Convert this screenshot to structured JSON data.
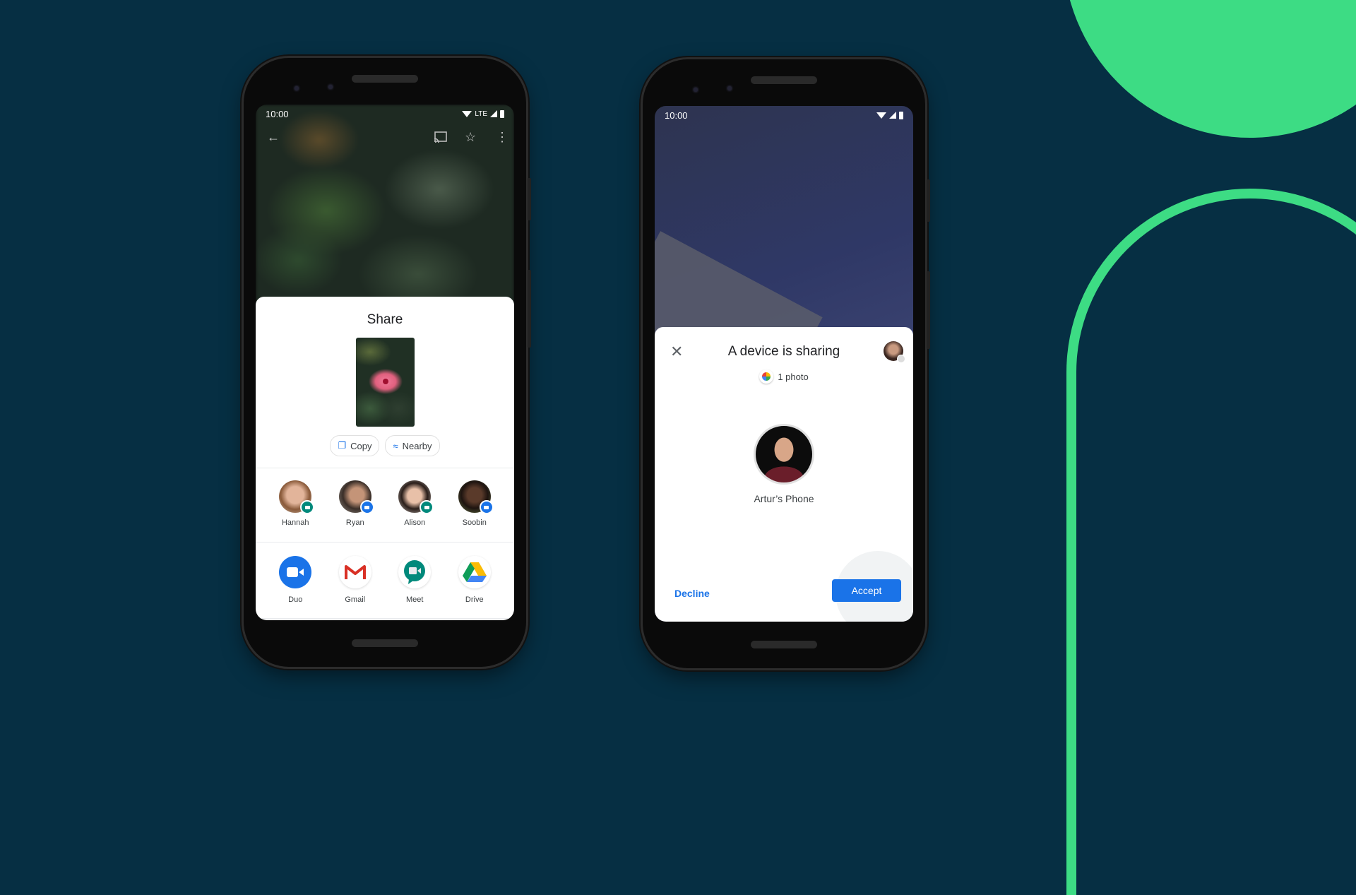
{
  "colors": {
    "background": "#062f43",
    "accent_green": "#3ddc84",
    "google_blue": "#1a73e8"
  },
  "phone_left": {
    "status": {
      "time": "10:00",
      "network": "LTE",
      "icons": [
        "wifi-icon",
        "signal-icon",
        "battery-icon"
      ]
    },
    "toolbar": {
      "icons": [
        "back-arrow-icon",
        "cast-icon",
        "star-icon",
        "more-vert-icon"
      ]
    },
    "share_sheet": {
      "title": "Share",
      "chips": [
        {
          "label": "Copy",
          "icon": "copy-icon"
        },
        {
          "label": "Nearby",
          "icon": "nearby-share-icon"
        }
      ],
      "people": [
        {
          "name": "Hannah",
          "app": "meet"
        },
        {
          "name": "Ryan",
          "app": "messages"
        },
        {
          "name": "Alison",
          "app": "meet"
        },
        {
          "name": "Soobin",
          "app": "duo"
        }
      ],
      "apps": [
        {
          "name": "Duo",
          "icon": "duo-icon"
        },
        {
          "name": "Gmail",
          "icon": "gmail-icon"
        },
        {
          "name": "Meet",
          "icon": "meet-icon"
        },
        {
          "name": "Drive",
          "icon": "drive-icon"
        }
      ]
    }
  },
  "phone_right": {
    "status": {
      "time": "10:00",
      "icons": [
        "wifi-icon",
        "signal-icon",
        "battery-icon"
      ]
    },
    "dialog": {
      "title": "A device is sharing",
      "content_count": "1 photo",
      "sender_name": "Artur’s Phone",
      "decline_label": "Decline",
      "accept_label": "Accept"
    }
  }
}
